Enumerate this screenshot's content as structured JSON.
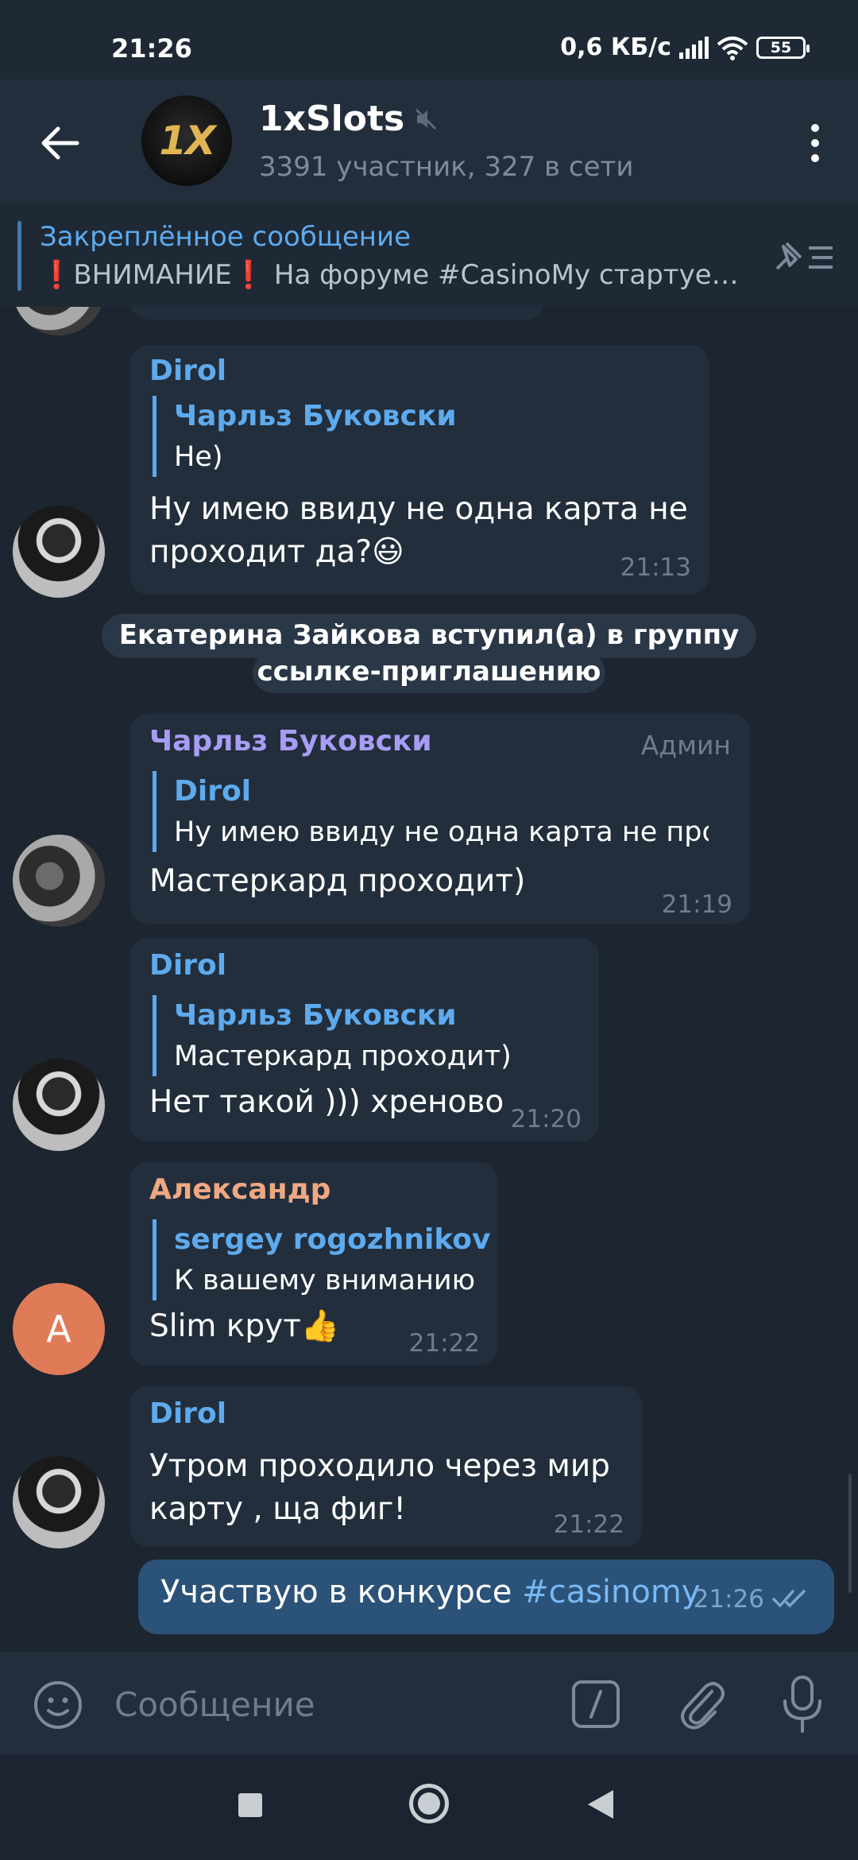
{
  "status_bar": {
    "time": "21:26",
    "net_speed": "0,6 КБ/с",
    "battery": "55"
  },
  "header": {
    "title": "1xSlots",
    "avatar_text": "1X",
    "subtitle": "3391 участник, 327 в сети",
    "muted_icon": "muted-speaker-icon"
  },
  "pinned": {
    "label": "Закреплённое сообщение",
    "text": "❗ВНИМАНИЕ❗ На форуме #CasinoMy стартуе…"
  },
  "messages": [
    {
      "sender": "Dirol",
      "reply_name": "Чарльз Буковски",
      "reply_text": "Не)",
      "text_line1": "Ну имею ввиду не одна карта не",
      "text_line2": "проходит да?😃",
      "time": "21:13"
    },
    {
      "service": "Екатерина Зайкова вступил(а) в группу по",
      "service2": "ссылке-приглашению"
    },
    {
      "sender": "Чарльз Буковски",
      "badge": "Админ",
      "reply_name": "Dirol",
      "reply_text": "Ну имею ввиду не одна карта не про…",
      "text": "Мастеркард проходит)",
      "time": "21:19"
    },
    {
      "sender": "Dirol",
      "reply_name": "Чарльз Буковски",
      "reply_text": "Мастеркард проходит)",
      "text": "Нет такой ))) хреново",
      "time": "21:20"
    },
    {
      "sender": "Александр",
      "avatar_letter": "А",
      "reply_name": "sergey rogozhnikov",
      "reply_text": "К вашему вниманию",
      "text": "Slim крут👍",
      "time": "21:22"
    },
    {
      "sender": "Dirol",
      "text_line1": "Утром проходило через мир",
      "text_line2": "карту , ща фиг!",
      "time": "21:22"
    }
  ],
  "outgoing": {
    "text": "Участвую в конкурсе ",
    "hashtag": "#casinomy",
    "time": "21:26"
  },
  "input": {
    "placeholder": "Сообщение"
  },
  "colors": {
    "accent": "#5eaaee",
    "admin_name": "#a89cf5",
    "alexander_name": "#f0a882",
    "outgoing_bubble": "#2b5278",
    "incoming_bubble": "#222e3b"
  }
}
